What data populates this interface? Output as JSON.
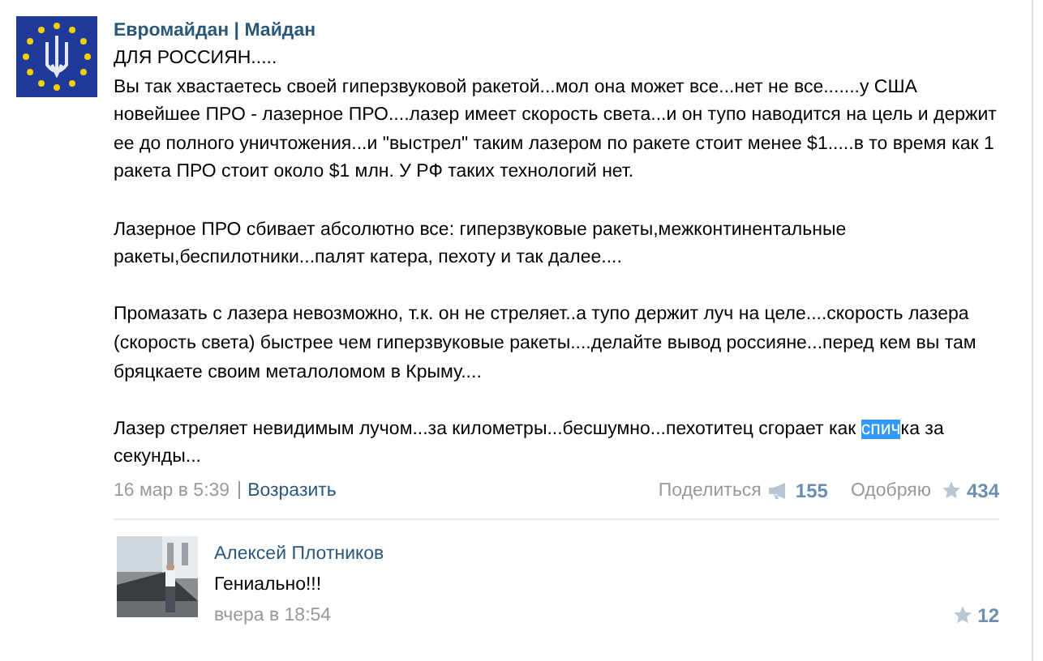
{
  "post": {
    "author": "Евромайдан | Майдан",
    "headline": "ДЛЯ РОССИЯН.....",
    "paragraphs": [
      {
        "segments": [
          {
            "text": "Вы так хвастаетесь своей гиперзвуковой ракетой...мол она может все...нет не все.......у США новейшее ПРО - лазерное ПРО....лазер имеет скорость света...и он тупо наводится на цель и держит ее до полного уничтожения...и \"выстрел\" таким лазером по ракете стоит менее $1.....в то время как 1 ракета ПРО стоит около $1 млн. У РФ таких технологий нет.",
            "selected": false
          }
        ]
      },
      {
        "segments": [
          {
            "text": "Лазерное ПРО сбивает абсолютно все: гиперзвуковые ракеты,межконтинентальные ракеты,беспилотники...палят катера, пехоту и так далее....",
            "selected": false
          }
        ]
      },
      {
        "segments": [
          {
            "text": "Промазать с лазера невозможно, т.к. он не стреляет..а тупо держит луч на целе....скорость лазера (скорость света) быстрее чем гиперзвуковые ракеты....делайте вывод россияне...перед кем вы там бряцкаете своим металоломом в Крыму....",
            "selected": false
          }
        ]
      },
      {
        "segments": [
          {
            "text": "Лазер стреляет невидимым лучом...за километры...бесшумно...пехотитец сгорает как ",
            "selected": false
          },
          {
            "text": "спич",
            "selected": true
          },
          {
            "text": "ка за секунды...",
            "selected": false
          }
        ]
      }
    ],
    "date": "16 мар в 5:39",
    "reply": "Возразить",
    "share": "Поделиться",
    "shares": "155",
    "like": "Одобряю",
    "likes": "434"
  },
  "comment": {
    "author": "Алексей Плотников",
    "text": "Гениально!!!",
    "date": "вчера в 18:54",
    "likes": "12"
  }
}
